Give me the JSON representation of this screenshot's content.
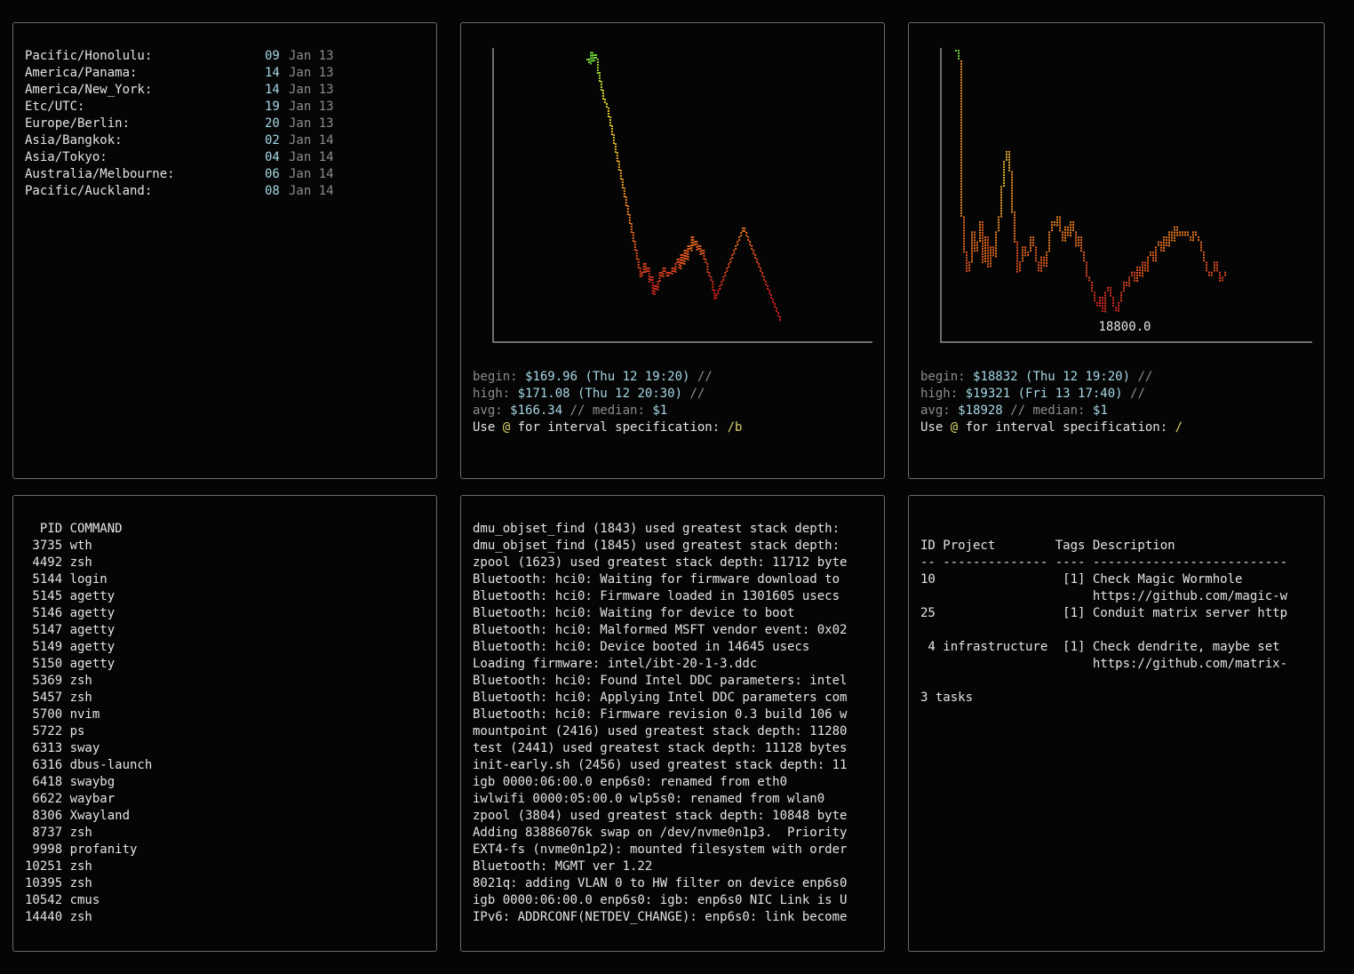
{
  "timezones": [
    {
      "name": "Pacific/Honolulu:",
      "hour": "09",
      "date": "Jan 13"
    },
    {
      "name": "America/Panama:",
      "hour": "14",
      "date": "Jan 13"
    },
    {
      "name": "America/New_York:",
      "hour": "14",
      "date": "Jan 13"
    },
    {
      "name": "Etc/UTC:",
      "hour": "19",
      "date": "Jan 13"
    },
    {
      "name": "Europe/Berlin:",
      "hour": "20",
      "date": "Jan 13"
    },
    {
      "name": "Asia/Bangkok:",
      "hour": "02",
      "date": "Jan 14"
    },
    {
      "name": "Asia/Tokyo:",
      "hour": "04",
      "date": "Jan 14"
    },
    {
      "name": "Australia/Melbourne:",
      "hour": "06",
      "date": "Jan 14"
    },
    {
      "name": "Pacific/Auckland:",
      "hour": "08",
      "date": "Jan 14"
    }
  ],
  "chart_data": [
    {
      "type": "line",
      "ylim": [
        165.5,
        171.1
      ],
      "x": [
        0,
        1,
        2,
        3,
        4,
        5,
        6,
        7,
        8,
        9,
        10,
        11,
        12,
        13,
        14,
        15,
        16,
        17,
        18,
        19,
        20,
        21,
        22,
        23,
        24,
        25,
        26,
        27,
        28,
        29,
        30,
        31,
        32,
        33,
        34,
        35,
        36,
        37,
        38,
        39,
        40,
        41,
        42,
        43,
        44,
        45,
        46,
        47,
        48,
        49,
        50,
        51,
        52,
        53,
        54,
        55,
        56,
        57,
        58,
        59,
        60,
        61,
        62,
        63,
        64,
        65,
        66,
        67,
        68,
        69,
        70,
        71,
        72,
        73,
        74,
        75,
        76,
        77,
        78,
        79,
        80,
        81,
        82,
        83,
        84,
        85,
        86,
        87,
        88,
        89,
        90,
        91,
        92,
        93,
        94,
        95,
        96,
        97,
        98,
        99,
        100,
        101,
        102,
        103,
        104,
        105,
        106,
        107,
        108,
        109
      ],
      "values": [
        170.9,
        170.8,
        171.05,
        170.85,
        171.0,
        170.9,
        170.6,
        170.4,
        170.2,
        170.0,
        169.9,
        169.8,
        169.6,
        169.4,
        169.2,
        169.0,
        168.8,
        168.6,
        168.4,
        168.2,
        168.0,
        167.8,
        167.6,
        167.4,
        167.2,
        167.0,
        166.8,
        166.6,
        166.4,
        166.2,
        166.0,
        166.1,
        166.3,
        166.1,
        166.2,
        165.9,
        166.0,
        165.6,
        165.8,
        165.7,
        165.9,
        166.1,
        166.0,
        166.2,
        166.1,
        166.0,
        166.1,
        166.05,
        166.2,
        166.1,
        166.3,
        166.4,
        166.2,
        166.5,
        166.3,
        166.6,
        166.4,
        166.7,
        166.6,
        166.9,
        166.7,
        166.8,
        166.6,
        166.7,
        166.5,
        166.6,
        166.4,
        166.3,
        166.1,
        166.0,
        165.9,
        165.7,
        165.5,
        165.6,
        165.7,
        165.8,
        165.9,
        166.0,
        166.1,
        166.2,
        166.3,
        166.4,
        166.5,
        166.6,
        166.7,
        166.8,
        166.9,
        167.0,
        167.1,
        167.0,
        166.9,
        166.8,
        166.7,
        166.6,
        166.5,
        166.4,
        166.3,
        166.2,
        166.1,
        166.0,
        165.9,
        165.8,
        165.7,
        165.6,
        165.5,
        165.4,
        165.3,
        165.2,
        165.1,
        165.0
      ]
    },
    {
      "type": "line",
      "ylim": [
        18800.0,
        19321
      ],
      "annotation": "18800.0",
      "x": [
        0,
        1,
        2,
        3,
        4,
        5,
        6,
        7,
        8,
        9,
        10,
        11,
        12,
        13,
        14,
        15,
        16,
        17,
        18,
        19,
        20,
        21,
        22,
        23,
        24,
        25,
        26,
        27,
        28,
        29,
        30,
        31,
        32,
        33,
        34,
        35,
        36,
        37,
        38,
        39,
        40,
        41,
        42,
        43,
        44,
        45,
        46,
        47,
        48,
        49,
        50,
        51,
        52,
        53,
        54,
        55,
        56,
        57,
        58,
        59,
        60,
        61,
        62,
        63,
        64,
        65,
        66,
        67,
        68,
        69,
        70,
        71,
        72,
        73,
        74,
        75,
        76,
        77,
        78,
        79,
        80,
        81,
        82,
        83,
        84,
        85,
        86,
        87,
        88,
        89,
        90,
        91,
        92,
        93,
        94,
        95,
        96,
        97,
        98,
        99,
        100,
        101
      ],
      "values": [
        19321,
        19300,
        18990,
        18920,
        18880,
        18900,
        18960,
        18920,
        18940,
        18980,
        18900,
        18950,
        18890,
        18930,
        18910,
        18960,
        18990,
        19050,
        19100,
        19120,
        19080,
        19000,
        18940,
        18880,
        18900,
        18930,
        18910,
        18920,
        18950,
        18930,
        18900,
        18880,
        18910,
        18890,
        18920,
        18960,
        18980,
        18970,
        18990,
        18960,
        18940,
        18970,
        18950,
        18980,
        18960,
        18930,
        18950,
        18920,
        18900,
        18870,
        18860,
        18840,
        18820,
        18810,
        18830,
        18800,
        18840,
        18850,
        18830,
        18810,
        18800,
        18820,
        18840,
        18860,
        18850,
        18870,
        18880,
        18860,
        18890,
        18870,
        18900,
        18880,
        18910,
        18920,
        18900,
        18930,
        18940,
        18920,
        18950,
        18930,
        18960,
        18940,
        18970,
        18950,
        18960,
        18950,
        18960,
        18950,
        18940,
        18960,
        18950,
        18940,
        18920,
        18900,
        18880,
        18870,
        18880,
        18900,
        18880,
        18860,
        18870,
        18880
      ]
    }
  ],
  "chart1_stats": {
    "begin_label": "begin: ",
    "begin_value": "$169.96 (Thu 12 19:20)",
    "begin_sep": " //",
    "high_label": "high: ",
    "high_value": "$171.08 (Thu 12 20:30)",
    "high_sep": " //",
    "avg_label": "avg: ",
    "avg_value": "$166.34",
    "avg_mid": " // median: ",
    "median_value": "$1",
    "use_pre": "Use ",
    "use_at": "@",
    "use_mid": " for interval specification: ",
    "use_val": "/b"
  },
  "chart2_stats": {
    "begin_label": "begin: ",
    "begin_value": "$18832 (Thu 12 19:20)",
    "begin_sep": " //",
    "high_label": "high: ",
    "high_value": "$19321 (Fri 13 17:40)",
    "high_sep": " //",
    "avg_label": "avg: ",
    "avg_value": "$18928",
    "avg_mid": " // median: ",
    "median_value": "$1",
    "use_pre": "Use ",
    "use_at": "@",
    "use_mid": " for interval specification: ",
    "use_val": "/"
  },
  "ps_lines": [
    "  PID COMMAND",
    " 3735 wth",
    " 4492 zsh",
    " 5144 login",
    " 5145 agetty",
    " 5146 agetty",
    " 5147 agetty",
    " 5149 agetty",
    " 5150 agetty",
    " 5369 zsh",
    " 5457 zsh",
    " 5700 nvim",
    " 5722 ps",
    " 6313 sway",
    " 6316 dbus-launch",
    " 6418 swaybg",
    " 6622 waybar",
    " 8306 Xwayland",
    " 8737 zsh",
    " 9998 profanity",
    "10251 zsh",
    "10395 zsh",
    "10542 cmus",
    "14440 zsh"
  ],
  "log_lines": [
    "dmu_objset_find (1843) used greatest stack depth:",
    "dmu_objset_find (1845) used greatest stack depth:",
    "zpool (1623) used greatest stack depth: 11712 byte",
    "Bluetooth: hci0: Waiting for firmware download to",
    "Bluetooth: hci0: Firmware loaded in 1301605 usecs",
    "Bluetooth: hci0: Waiting for device to boot",
    "Bluetooth: hci0: Malformed MSFT vendor event: 0x02",
    "Bluetooth: hci0: Device booted in 14645 usecs",
    "Loading firmware: intel/ibt-20-1-3.ddc",
    "Bluetooth: hci0: Found Intel DDC parameters: intel",
    "Bluetooth: hci0: Applying Intel DDC parameters com",
    "Bluetooth: hci0: Firmware revision 0.3 build 106 w",
    "mountpoint (2416) used greatest stack depth: 11280",
    "test (2441) used greatest stack depth: 11128 bytes",
    "init-early.sh (2456) used greatest stack depth: 11",
    "igb 0000:06:00.0 enp6s0: renamed from eth0",
    "iwlwifi 0000:05:00.0 wlp5s0: renamed from wlan0",
    "zpool (3804) used greatest stack depth: 10848 byte",
    "Adding 83886076k swap on /dev/nvme0n1p3.  Priority",
    "EXT4-fs (nvme0n1p2): mounted filesystem with order",
    "Bluetooth: MGMT ver 1.22",
    "8021q: adding VLAN 0 to HW filter on device enp6s0",
    "igb 0000:06:00.0 enp6s0: igb: enp6s0 NIC Link is U",
    "IPv6: ADDRCONF(NETDEV_CHANGE): enp6s0: link become"
  ],
  "task_lines": [
    "ID Project        Tags Description",
    "-- -------------- ---- --------------------------",
    "10                 [1] Check Magic Wormhole",
    "                       https://github.com/magic-w",
    "25                 [1] Conduit matrix server http",
    "",
    " 4 infrastructure  [1] Check dendrite, maybe set",
    "                       https://github.com/matrix-",
    "",
    "3 tasks"
  ]
}
